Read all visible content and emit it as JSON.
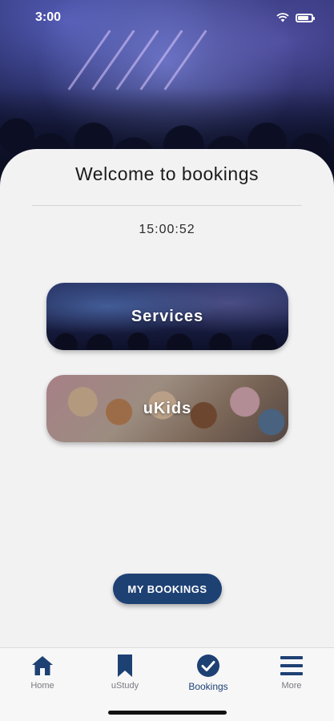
{
  "status_bar": {
    "time": "3:00"
  },
  "header": {
    "title": "Welcome to bookings"
  },
  "clock": {
    "time": "15:00:52"
  },
  "tiles": [
    {
      "label": "Services"
    },
    {
      "label": "uKids"
    }
  ],
  "actions": {
    "my_bookings_label": "MY BOOKINGS"
  },
  "tabbar": {
    "items": [
      {
        "label": "Home",
        "icon": "home-icon"
      },
      {
        "label": "uStudy",
        "icon": "bookmark-icon"
      },
      {
        "label": "Bookings",
        "icon": "check-circle-icon",
        "active": true
      },
      {
        "label": "More",
        "icon": "menu-icon"
      }
    ]
  },
  "colors": {
    "accent": "#1e4174",
    "background": "#f2f2f3",
    "inactive": "#7a7a80"
  }
}
